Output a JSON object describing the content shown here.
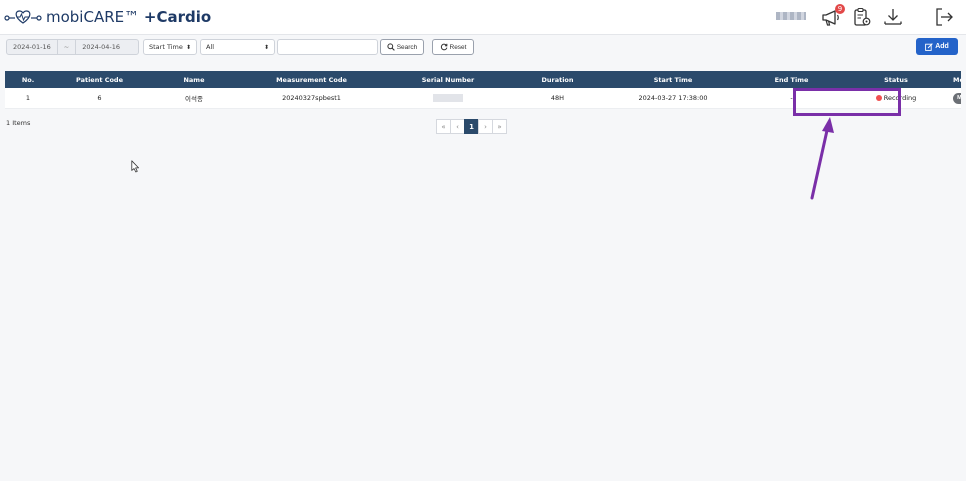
{
  "header": {
    "brand": "mobiCARE™",
    "brand_plus": "+Cardio",
    "notification_count": "9"
  },
  "filters": {
    "date_from": "2024-01-16",
    "date_sep": "~",
    "date_to": "2024-04-16",
    "time_field": "Start Time",
    "category": "All",
    "search_value": "",
    "search_label": "Search",
    "reset_label": "Reset",
    "add_label": "Add"
  },
  "table": {
    "columns": [
      "No.",
      "Patient Code",
      "Name",
      "Measurement Code",
      "Serial Number",
      "Duration",
      "Start Time",
      "End Time",
      "Status",
      "Modify"
    ],
    "rows": [
      {
        "no": "1",
        "patient_code": "6",
        "name": "이석종",
        "measurement_code": "20240327spbest1",
        "duration": "48H",
        "start_time": "2024-03-27 17:38:00",
        "end_time": "-",
        "status": "Recording",
        "modify_label": "Modify"
      }
    ]
  },
  "footer": {
    "items_count": "1 Items"
  },
  "pagination": {
    "first": "«",
    "prev": "‹",
    "current": "1",
    "next": "›",
    "last": "»"
  },
  "colors": {
    "header_bar": "#2b4a6b",
    "add_button": "#2463c9",
    "recording_dot": "#f05050",
    "annotation": "#7a2fa8"
  }
}
